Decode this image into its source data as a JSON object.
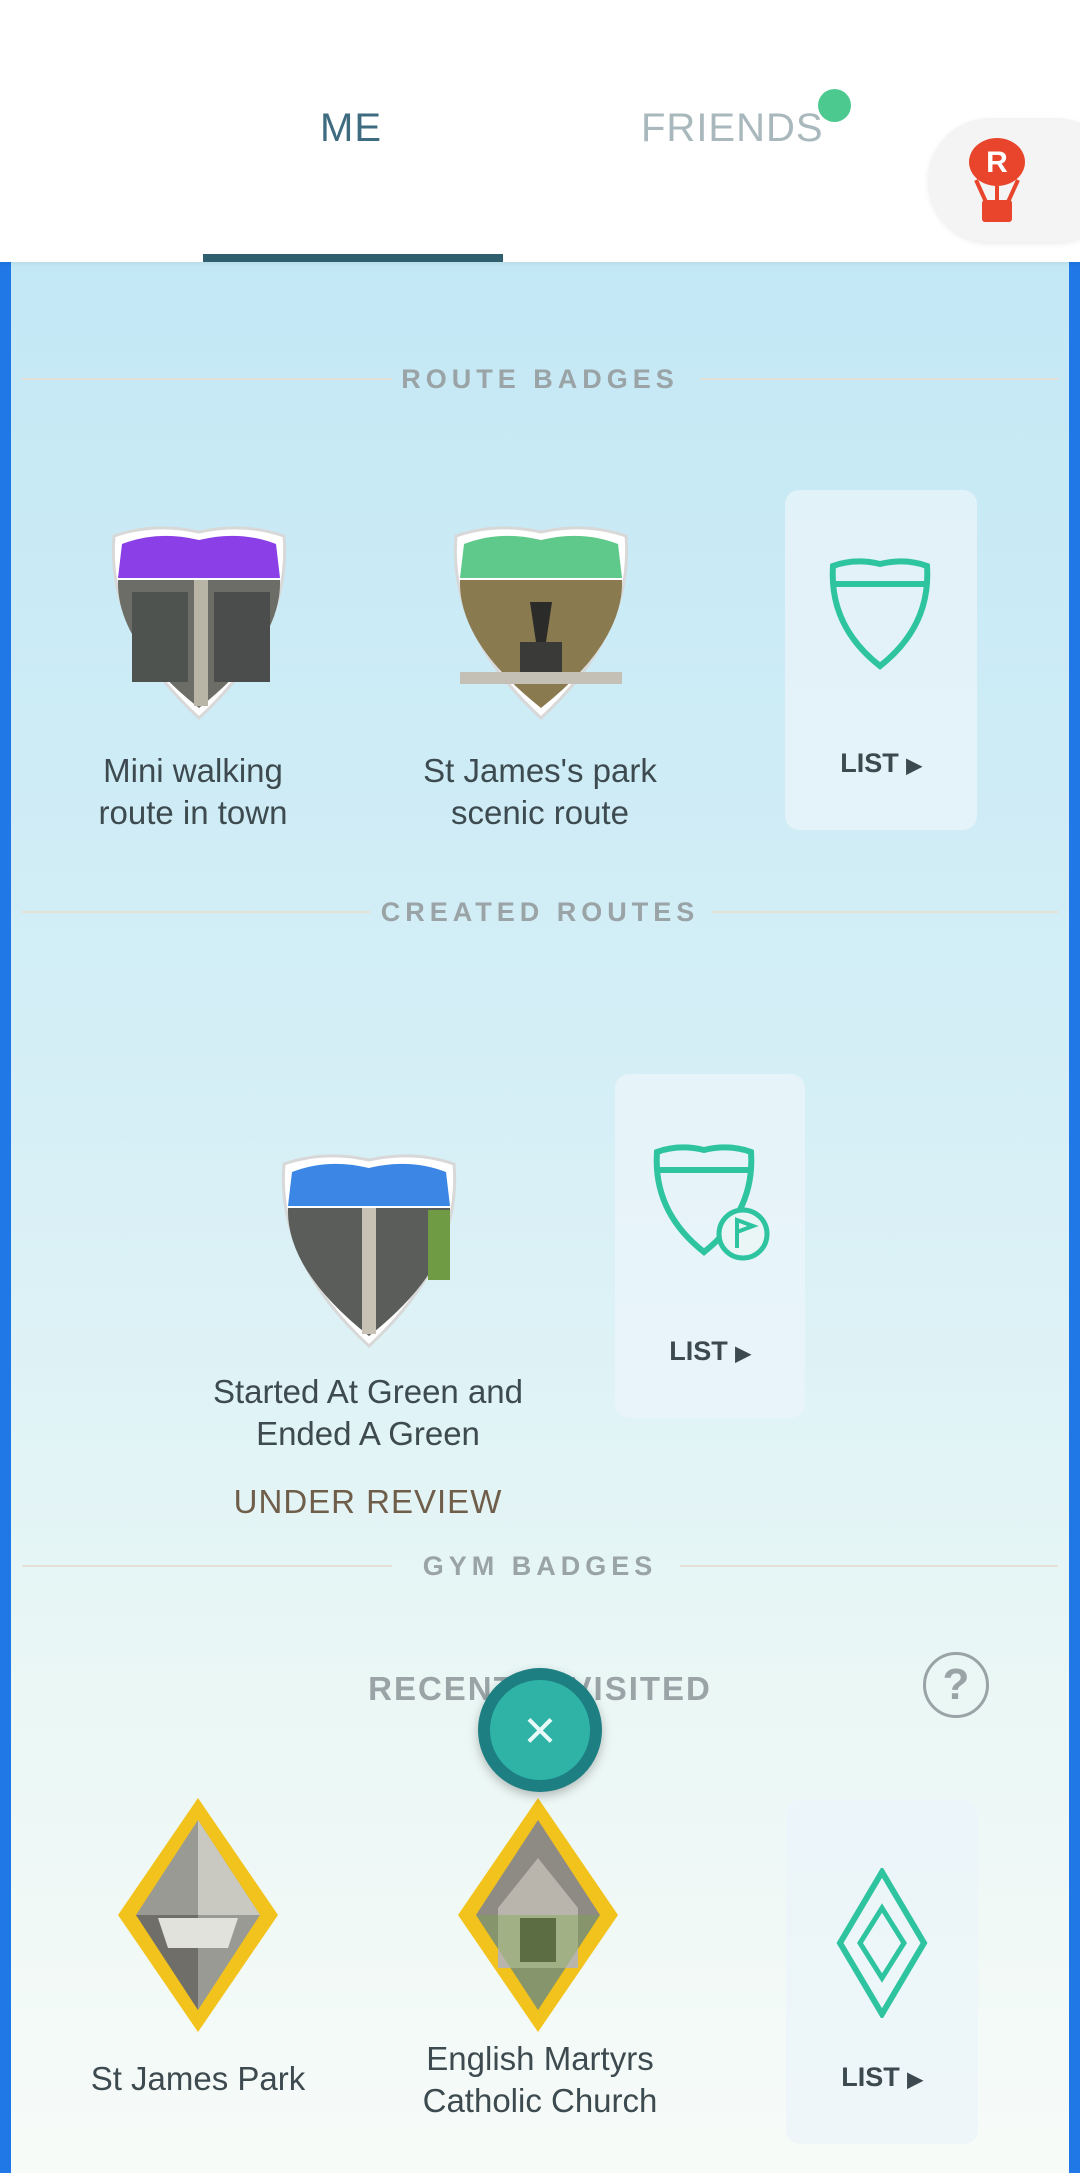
{
  "tabs": {
    "me": "ME",
    "friends": "FRIENDS"
  },
  "sections": {
    "route_badges": "ROUTE BADGES",
    "created_routes": "CREATED ROUTES",
    "gym_badges": "GYM BADGES"
  },
  "route_badges": [
    {
      "label_line1": "Mini walking",
      "label_line2": "route in town",
      "color": "#8b3fe6"
    },
    {
      "label_line1": "St James's park",
      "label_line2": "scenic route",
      "color": "#5ec98a"
    }
  ],
  "created_route": {
    "label_line1": "Started At Green and",
    "label_line2": "Ended A Green",
    "status": "UNDER REVIEW",
    "color": "#3c86e6"
  },
  "list_label": "LIST",
  "gym": {
    "recently_visited": "RECENTLY VISITED",
    "help_icon": "?",
    "badges": [
      {
        "label_line1": "St James Park",
        "label_line2": ""
      },
      {
        "label_line1": "English Martyrs",
        "label_line2": "Catholic Church"
      }
    ]
  },
  "close_icon": "×",
  "colors": {
    "accent": "#2fc4a0",
    "tab_underline": "#2f5e6f",
    "edge": "#1f78e6"
  }
}
